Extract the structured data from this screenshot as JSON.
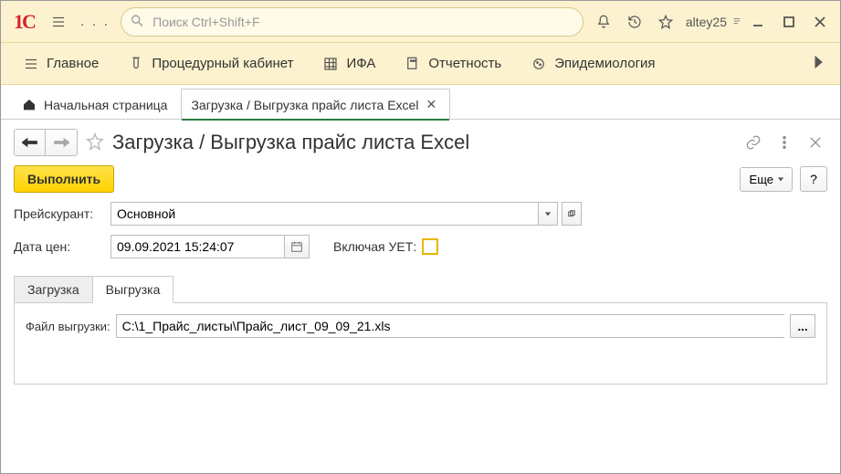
{
  "titlebar": {
    "search_placeholder": "Поиск Ctrl+Shift+F",
    "user": "altey25",
    "dots": ". . ."
  },
  "mainmenu": {
    "items": [
      {
        "label": "Главное"
      },
      {
        "label": "Процедурный кабинет"
      },
      {
        "label": "ИФА"
      },
      {
        "label": "Отчетность"
      },
      {
        "label": "Эпидемиология"
      }
    ]
  },
  "doctabs": {
    "home": "Начальная страница",
    "active": "Загрузка / Выгрузка прайс листа Excel"
  },
  "page": {
    "title": "Загрузка / Выгрузка прайс листа Excel",
    "execute": "Выполнить",
    "more": "Еще",
    "help": "?"
  },
  "form": {
    "price_list_label": "Прейскурант:",
    "price_list_value": "Основной",
    "date_label": "Дата цен:",
    "date_value": "09.09.2021 15:24:07",
    "uet_label": "Включая УЕТ:"
  },
  "inner_tabs": {
    "load": "Загрузка",
    "unload": "Выгрузка",
    "file_label": "Файл выгрузки:",
    "file_value": "C:\\1_Прайс_листы\\Прайс_лист_09_09_21.xls",
    "browse": "..."
  }
}
